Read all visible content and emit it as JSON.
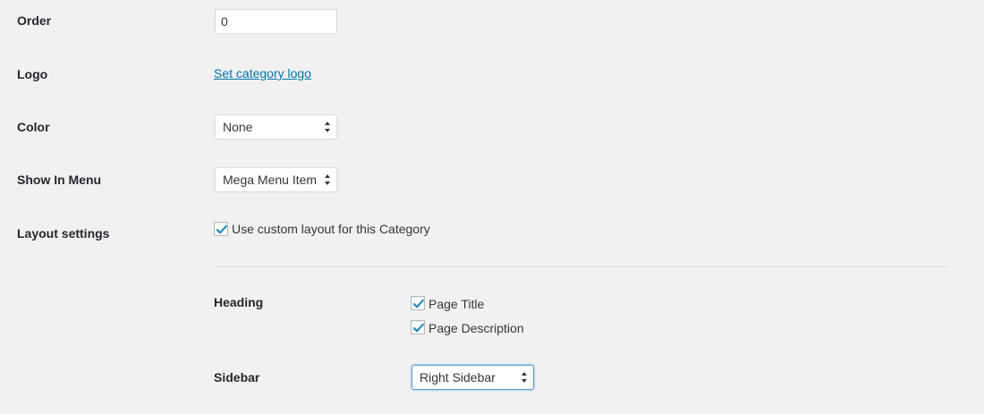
{
  "form": {
    "order": {
      "label": "Order",
      "value": "0"
    },
    "logo": {
      "label": "Logo",
      "link_text": "Set category logo"
    },
    "color": {
      "label": "Color",
      "selected": "None"
    },
    "show_in_menu": {
      "label": "Show In Menu",
      "selected": "Mega Menu Item"
    },
    "layout_settings": {
      "label": "Layout settings",
      "custom_layout_label": "Use custom layout for this Category",
      "custom_layout_checked": true
    },
    "heading": {
      "label": "Heading",
      "page_title_label": "Page Title",
      "page_title_checked": true,
      "page_description_label": "Page Description",
      "page_description_checked": true
    },
    "sidebar": {
      "label": "Sidebar",
      "selected": "Right Sidebar"
    }
  },
  "colors": {
    "link": "#0073aa",
    "checkmark": "#1e8cbe",
    "background": "#f1f1f1",
    "focus_border": "#5b9dd9"
  }
}
